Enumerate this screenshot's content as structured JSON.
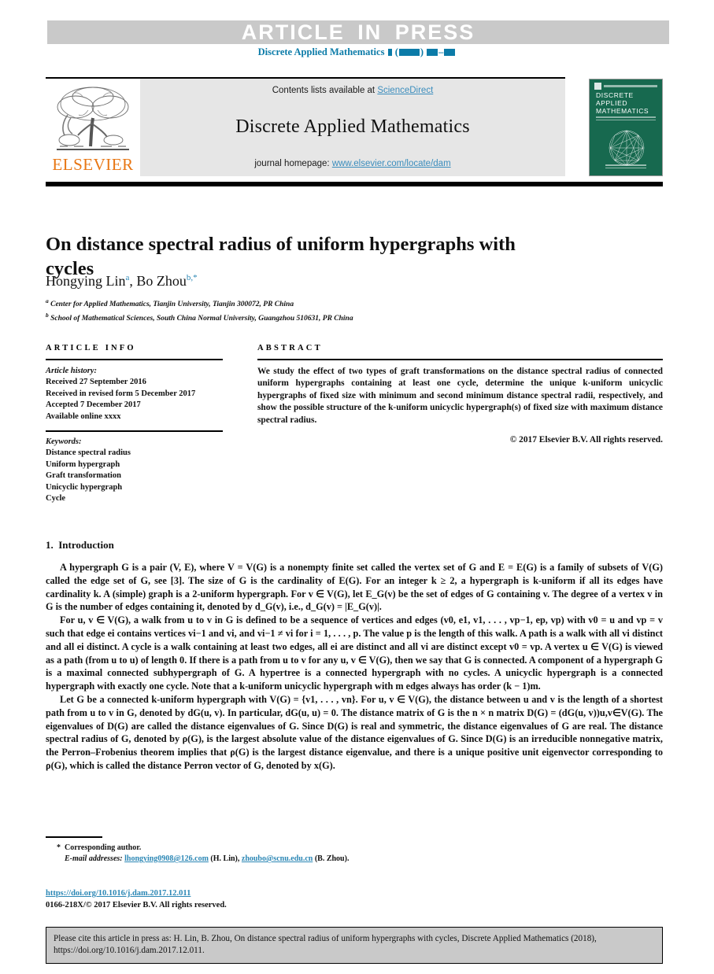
{
  "header": {
    "press_banner": "ARTICLE IN PRESS",
    "journal_ref_prefix": "Discrete Applied Mathematics",
    "journal_ref_redacted": "( ) –"
  },
  "masthead": {
    "contents_prefix": "Contents lists available at ",
    "sciencedirect": "ScienceDirect",
    "journal_title": "Discrete Applied Mathematics",
    "homepage_prefix": "journal homepage: ",
    "homepage_url": "www.elsevier.com/locate/dam",
    "publisher_wordmark": "ELSEVIER",
    "cover": {
      "title_line1": "DISCRETE",
      "title_line2": "APPLIED",
      "title_line3": "MATHEMATICS"
    }
  },
  "article": {
    "title": "On distance spectral radius of uniform hypergraphs with cycles",
    "authors": [
      {
        "name": "Hongying Lin",
        "mark": "a"
      },
      {
        "name": "Bo Zhou",
        "mark": "b,*"
      }
    ],
    "affiliations": [
      {
        "mark": "a",
        "text": "Center for Applied Mathematics, Tianjin University, Tianjin 300072, PR China"
      },
      {
        "mark": "b",
        "text": "School of Mathematical Sciences, South China Normal University, Guangzhou 510631, PR China"
      }
    ]
  },
  "article_info": {
    "heading": "ARTICLE INFO",
    "history_label": "Article history:",
    "history": [
      "Received 27 September 2016",
      "Received in revised form 5 December 2017",
      "Accepted 7 December 2017",
      "Available online xxxx"
    ],
    "keywords_label": "Keywords:",
    "keywords": [
      "Distance spectral radius",
      "Uniform hypergraph",
      "Graft transformation",
      "Unicyclic hypergraph",
      "Cycle"
    ]
  },
  "abstract": {
    "heading": "ABSTRACT",
    "text": "We study the effect of two types of graft transformations on the distance spectral radius of connected uniform hypergraphs containing at least one cycle, determine the unique k-uniform unicyclic hypergraphs of fixed size with minimum and second minimum distance spectral radii, respectively, and show the possible structure of the k-uniform unicyclic hypergraph(s) of fixed size with maximum distance spectral radius.",
    "copyright": "© 2017 Elsevier B.V. All rights reserved."
  },
  "body": {
    "section_number": "1.",
    "section_title": "Introduction",
    "paragraph1": "A hypergraph G is a pair (V, E), where V = V(G) is a nonempty finite set called the vertex set of G and E = E(G) is a family of subsets of V(G) called the edge set of G, see [3]. The size of G is the cardinality of E(G). For an integer k ≥ 2, a hypergraph is k-uniform if all its edges have cardinality k. A (simple) graph is a 2-uniform hypergraph. For v ∈ V(G), let E_G(v) be the set of edges of G containing v. The degree of a vertex v in G is the number of edges containing it, denoted by d_G(v), i.e., d_G(v) = |E_G(v)|.",
    "citation_ref": "3",
    "paragraph2": "For u, v ∈ V(G), a walk from u to v in G is defined to be a sequence of vertices and edges (v0, e1, v1, . . . , vp−1, ep, vp) with v0 = u and vp = v such that edge ei contains vertices vi−1 and vi, and vi−1 ≠ vi for i = 1, . . . , p. The value p is the length of this walk. A path is a walk with all vi distinct and all ei distinct. A cycle is a walk containing at least two edges, all ei are distinct and all vi are distinct except v0 = vp. A vertex u ∈ V(G) is viewed as a path (from u to u) of length 0. If there is a path from u to v for any u, v ∈ V(G), then we say that G is connected. A component of a hypergraph G is a maximal connected subhypergraph of G. A hypertree is a connected hypergraph with no cycles. A unicyclic hypergraph is a connected hypergraph with exactly one cycle. Note that a k-uniform unicyclic hypergraph with m edges always has order (k − 1)m.",
    "paragraph3": "Let G be a connected k-uniform hypergraph with V(G) = {v1, . . . , vn}. For u, v ∈ V(G), the distance between u and v is the length of a shortest path from u to v in G, denoted by dG(u, v). In particular, dG(u, u) = 0. The distance matrix of G is the n × n matrix D(G) = (dG(u, v))u,v∈V(G). The eigenvalues of D(G) are called the distance eigenvalues of G. Since D(G) is real and symmetric, the distance eigenvalues of G are real. The distance spectral radius of G, denoted by ρ(G), is the largest absolute value of the distance eigenvalues of G. Since D(G) is an irreducible nonnegative matrix, the Perron–Frobenius theorem implies that ρ(G) is the largest distance eigenvalue, and there is a unique positive unit eigenvector corresponding to ρ(G), which is called the distance Perron vector of G, denoted by x(G)."
  },
  "footnotes": {
    "corresponding": "Corresponding author.",
    "email_label": "E-mail addresses:",
    "email1": "lhongying0908@126.com",
    "email1_owner": "(H. Lin)",
    "email2": "zhoubo@scnu.edu.cn",
    "email2_owner": "(B. Zhou).",
    "doi": "https://doi.org/10.1016/j.dam.2017.12.011",
    "issn_line": "0166-218X/© 2017 Elsevier B.V. All rights reserved."
  },
  "cite_footer": {
    "line1": "Please cite this article in press as: H. Lin, B. Zhou, On distance spectral radius of uniform hypergraphs with cycles, Discrete Applied Mathematics (2018),",
    "line2": "https://doi.org/10.1016/j.dam.2017.12.011."
  },
  "colors": {
    "link_blue": "#2b87b5",
    "journal_teal": "#0b7ba8",
    "elsevier_orange": "#e87613",
    "cover_green": "#17694f",
    "band_gray": "#c9c9c9"
  }
}
